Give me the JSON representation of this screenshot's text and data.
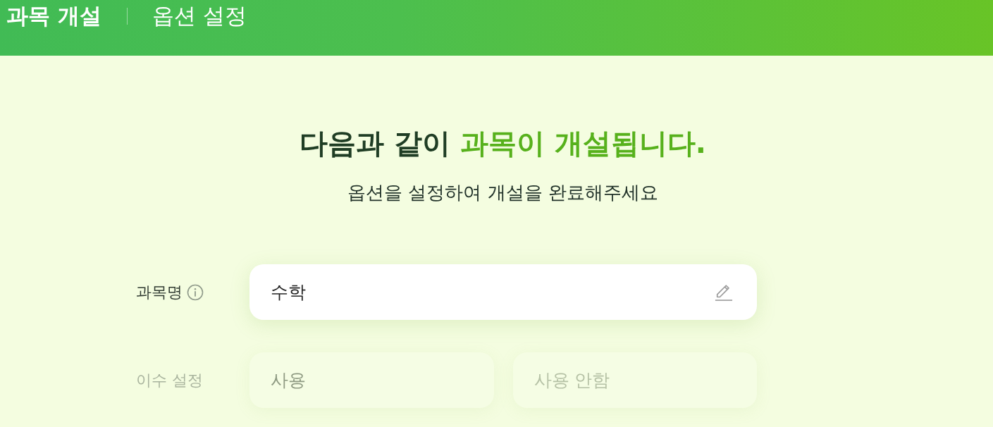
{
  "header": {
    "title": "과목 개설",
    "section": "옵션 설정"
  },
  "intro": {
    "heading": "다음과 같이 **과목이 개설됩니다.**",
    "subtitle": "옵션을 설정하여 개설을 완료해주세요"
  },
  "fields": [
    {
      "kind": "text",
      "label": "과목명",
      "info": true,
      "disabled": false,
      "value": "수학"
    },
    {
      "kind": "choice",
      "label": "이수 설정",
      "info": false,
      "disabled": true,
      "options": [
        {
          "label": "사용",
          "selected": true
        },
        {
          "label": "사용 안함",
          "selected": false
        }
      ]
    }
  ]
}
